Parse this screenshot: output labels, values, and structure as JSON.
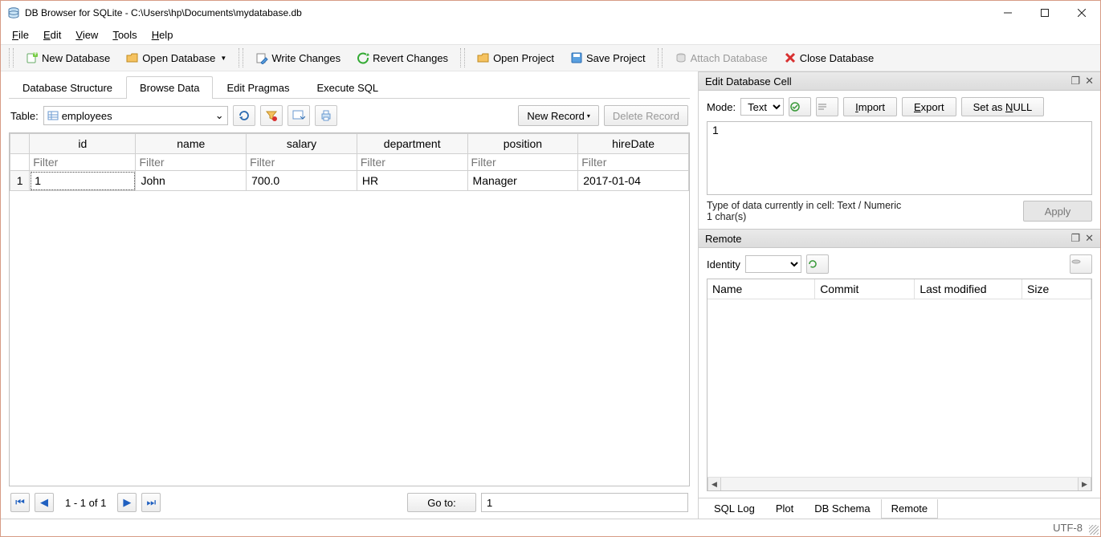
{
  "title": "DB Browser for SQLite - C:\\Users\\hp\\Documents\\mydatabase.db",
  "menu": {
    "file": "File",
    "edit": "Edit",
    "view": "View",
    "tools": "Tools",
    "help": "Help"
  },
  "toolbar": {
    "new_db": "New Database",
    "open_db": "Open Database",
    "write_changes": "Write Changes",
    "revert_changes": "Revert Changes",
    "open_project": "Open Project",
    "save_project": "Save Project",
    "attach_db": "Attach Database",
    "close_db": "Close Database"
  },
  "tabs": {
    "structure": "Database Structure",
    "browse": "Browse Data",
    "pragmas": "Edit Pragmas",
    "execute": "Execute SQL"
  },
  "browse": {
    "table_label": "Table:",
    "selected_table": "employees",
    "new_record": "New Record",
    "delete_record": "Delete Record",
    "columns": [
      "id",
      "name",
      "salary",
      "department",
      "position",
      "hireDate"
    ],
    "filter_placeholder": "Filter",
    "row_num": "1",
    "row": {
      "id": "1",
      "name": "John",
      "salary": "700.0",
      "department": "HR",
      "position": "Manager",
      "hireDate": "2017-01-04"
    },
    "page_info": "1 - 1 of 1",
    "goto_label": "Go to:",
    "goto_value": "1"
  },
  "edit_cell": {
    "title": "Edit Database Cell",
    "mode_label": "Mode:",
    "mode_value": "Text",
    "import_label": "Import",
    "export_label": "Export",
    "setnull_label": "Set as NULL",
    "cell_value": "1",
    "type_info": "Type of data currently in cell: Text / Numeric",
    "char_info": "1 char(s)",
    "apply_label": "Apply"
  },
  "remote": {
    "title": "Remote",
    "identity_label": "Identity",
    "cols": {
      "name": "Name",
      "commit": "Commit",
      "modified": "Last modified",
      "size": "Size"
    }
  },
  "bottom_tabs": {
    "sql_log": "SQL Log",
    "plot": "Plot",
    "db_schema": "DB Schema",
    "remote": "Remote"
  },
  "status": {
    "encoding": "UTF-8"
  }
}
